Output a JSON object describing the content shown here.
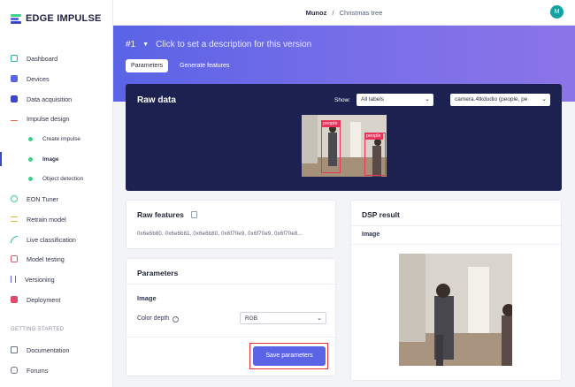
{
  "app": {
    "logo_text": "EDGE IMPULSE"
  },
  "sidebar": {
    "items": [
      {
        "label": "Dashboard",
        "icon": "monitor-icon"
      },
      {
        "label": "Devices",
        "icon": "chip-icon"
      },
      {
        "label": "Data acquisition",
        "icon": "database-icon"
      },
      {
        "label": "Impulse design",
        "icon": "pulse-icon"
      },
      {
        "label": "EON Tuner",
        "icon": "tuner-icon"
      },
      {
        "label": "Retrain model",
        "icon": "shuffle-icon"
      },
      {
        "label": "Live classification",
        "icon": "signal-icon"
      },
      {
        "label": "Model testing",
        "icon": "checklist-icon"
      },
      {
        "label": "Versioning",
        "icon": "branch-icon"
      },
      {
        "label": "Deployment",
        "icon": "package-icon"
      }
    ],
    "sub_items": [
      {
        "label": "Create impulse"
      },
      {
        "label": "Image"
      },
      {
        "label": "Object detection"
      }
    ],
    "section_header": "GETTING STARTED",
    "footer_items": [
      {
        "label": "Documentation",
        "icon": "book-icon"
      },
      {
        "label": "Forums",
        "icon": "forum-icon"
      }
    ]
  },
  "topbar": {
    "user": "Munoz",
    "separator": "/",
    "project": "Christmas tree",
    "avatar_initial": "M"
  },
  "banner": {
    "version": "#1",
    "description_prompt": "Click to set a description for this version",
    "tabs": [
      "Parameters",
      "Generate features"
    ]
  },
  "raw_data": {
    "title": "Raw data",
    "show_label": "Show:",
    "filter_value": "All labels",
    "sample_value": "camera.4tkdudio (people, pe",
    "labels": [
      "people",
      "people"
    ]
  },
  "raw_features": {
    "title": "Raw features",
    "values": "0x6e6b80, 0x6e6b81, 0x6e6b80, 0x6f70e9, 0x6f70e9, 0x6f70e8..."
  },
  "parameters": {
    "title": "Parameters",
    "section": "Image",
    "color_depth_label": "Color depth",
    "color_depth_value": "RGB",
    "save_label": "Save parameters"
  },
  "dsp": {
    "title": "DSP result",
    "section": "Image"
  },
  "colors": {
    "accent": "#5b63e6",
    "sidebar_active": "#3b47c6",
    "raw_bg": "#1c2150",
    "highlight": "#e03434"
  }
}
